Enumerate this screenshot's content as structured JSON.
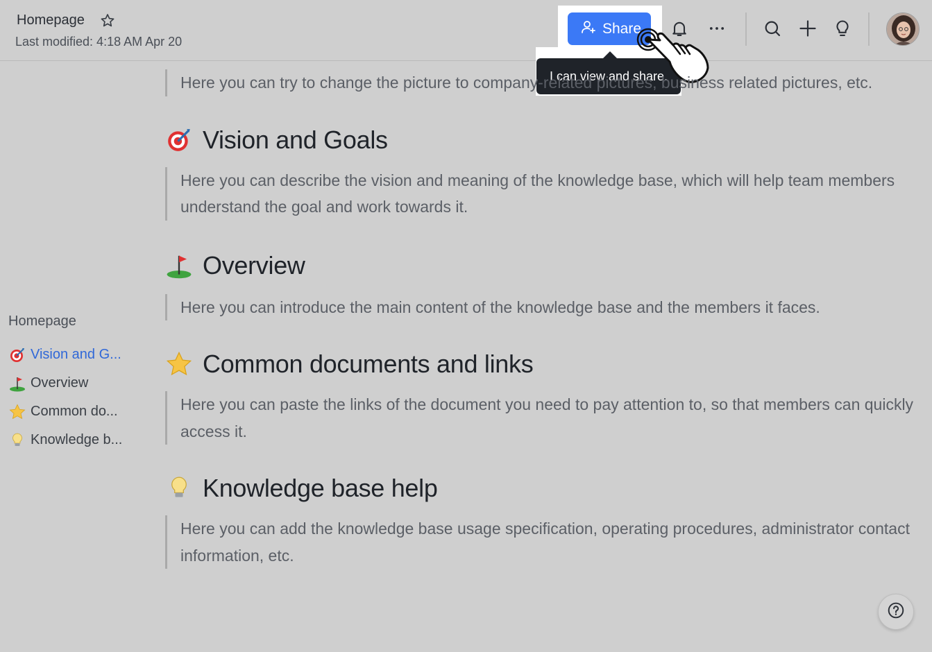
{
  "header": {
    "title": "Homepage",
    "last_modified": "Last modified: 4:18 AM Apr 20",
    "share_label": "Share",
    "tooltip": "I can view and share."
  },
  "outline": {
    "title": "Homepage",
    "items": [
      {
        "label": "Vision and G...",
        "icon": "target-icon",
        "active": true
      },
      {
        "label": "Overview",
        "icon": "golf-flag-icon",
        "active": false
      },
      {
        "label": "Common do...",
        "icon": "star-emoji-icon",
        "active": false
      },
      {
        "label": "Knowledge b...",
        "icon": "lightbulb-icon",
        "active": false
      }
    ]
  },
  "content": {
    "intro_text": "Here you can try to change the picture to company-related pictures, business related pictures, etc.",
    "sections": [
      {
        "heading": "Vision and Goals",
        "icon": "target-icon",
        "body": "Here you can describe the vision and meaning of the knowledge base, which will help team members understand the goal and work towards it."
      },
      {
        "heading": "Overview",
        "icon": "golf-flag-icon",
        "body": "Here you can introduce the main content of the knowledge base and the members it faces."
      },
      {
        "heading": "Common documents and links",
        "icon": "star-emoji-icon",
        "body": "Here you can paste the links of the document you need to pay attention to, so that members can quickly access it."
      },
      {
        "heading": "Knowledge base help",
        "icon": "lightbulb-icon",
        "body": "Here you can add the knowledge base usage specification, operating procedures, administrator contact information, etc."
      }
    ]
  },
  "colors": {
    "accent": "#3b79f6",
    "active_link": "#3068d8",
    "background": "#cfcfcf"
  }
}
